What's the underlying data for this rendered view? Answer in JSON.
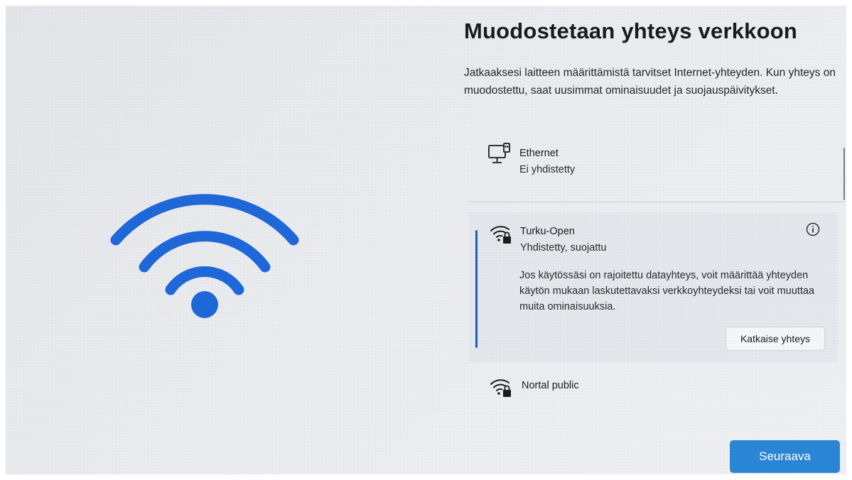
{
  "page": {
    "title": "Muodostetaan yhteys verkkoon",
    "description": "Jatkaaksesi laitteen määrittämistä tarvitset Internet-yhteyden. Kun yhteys on muodostettu, saat uusimmat ominaisuudet ja suojauspäivitykset."
  },
  "hero": {
    "icon": "wifi-icon",
    "color": "#1f68d9"
  },
  "networks": [
    {
      "name": "Ethernet",
      "status": "Ei yhdistetty",
      "icon": "ethernet-icon"
    },
    {
      "name": "Turku-Open",
      "status": "Yhdistetty, suojattu",
      "icon": "wifi-secured-icon",
      "selected": true,
      "details": "Jos käytössäsi on rajoitettu datayhteys, voit määrittää yhteyden käytön mukaan laskutettavaksi verkkoyhteydeksi tai voit muuttaa muita ominaisuuksia.",
      "action_label": "Katkaise yhteys"
    },
    {
      "name": "Nortal public",
      "icon": "wifi-secured-icon"
    }
  ],
  "footer": {
    "next_label": "Seuraava"
  },
  "colors": {
    "accent": "#2b86d6",
    "selection": "#1d5fb8"
  }
}
